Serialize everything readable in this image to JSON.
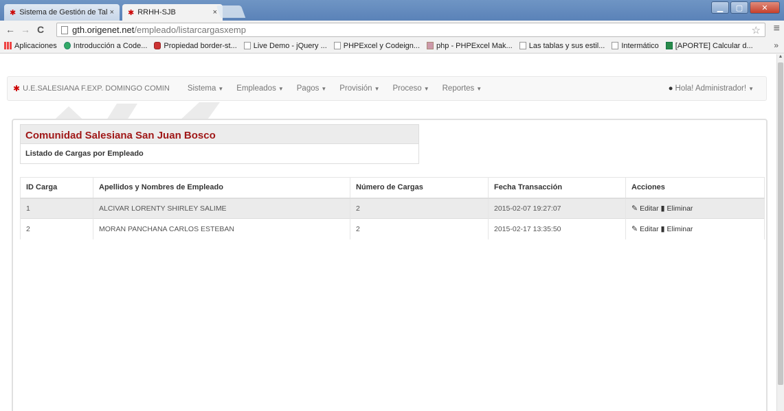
{
  "browser": {
    "tabs": [
      {
        "label": "Sistema de Gestión de Tal",
        "close": "×"
      },
      {
        "label": "RRHH-SJB",
        "close": "×"
      }
    ],
    "url_host": "gth.origenet.net",
    "url_path": "/empleado/listarcargasxemp",
    "bookmarks": [
      "Aplicaciones",
      "Introducción a Code...",
      "Propiedad border-st...",
      "Live Demo - jQuery ...",
      "PHPExcel y Codeign...",
      "php - PHPExcel Mak...",
      "Las tablas y sus estil...",
      "Intermático",
      "[APORTE] Calcular d..."
    ],
    "more": "»"
  },
  "app": {
    "brand": "U.E.SALESIANA F.EXP. DOMINGO COMIN",
    "menu": [
      {
        "label": "Sistema"
      },
      {
        "label": "Empleados"
      },
      {
        "label": "Pagos"
      },
      {
        "label": "Provisión"
      },
      {
        "label": "Proceso"
      },
      {
        "label": "Reportes"
      }
    ],
    "user": "Hola! Administrador!"
  },
  "panel": {
    "title": "Comunidad Salesiana San Juan Bosco",
    "subtitle": "Listado de Cargas por Empleado"
  },
  "table": {
    "headers": [
      "ID Carga",
      "Apellidos y Nombres de Empleado",
      "Número de Cargas",
      "Fecha Transacción",
      "Acciones"
    ],
    "rows": [
      {
        "id": "1",
        "name": "ALCIVAR LORENTY SHIRLEY SALIME",
        "cargas": "2",
        "fecha": "2015-02-07 19:27:07"
      },
      {
        "id": "2",
        "name": "MORAN PANCHANA CARLOS ESTEBAN",
        "cargas": "2",
        "fecha": "2015-02-17 13:35:50"
      }
    ],
    "edit_label": "Editar",
    "delete_label": "Eliminar"
  }
}
